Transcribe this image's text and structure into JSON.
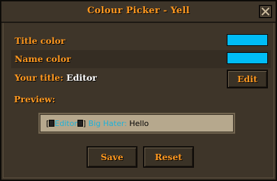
{
  "window": {
    "title": "Colour Picker - Yell"
  },
  "rows": {
    "title_color": {
      "label": "Title color",
      "color": "#00bdf6"
    },
    "name_color": {
      "label": "Name color",
      "color": "#00bdf6"
    },
    "your_title": {
      "label": "Your title:",
      "value": "Editor",
      "button": "Edit"
    }
  },
  "preview": {
    "label": "Preview:",
    "open_bracket": "[",
    "close_bracket": "]",
    "title": "Editor",
    "name": "Big Hater:",
    "message": "Hello",
    "badge_icon": "badge-icon"
  },
  "buttons": {
    "save": "Save",
    "reset": "Reset"
  },
  "icons": {
    "close": "close-icon"
  }
}
